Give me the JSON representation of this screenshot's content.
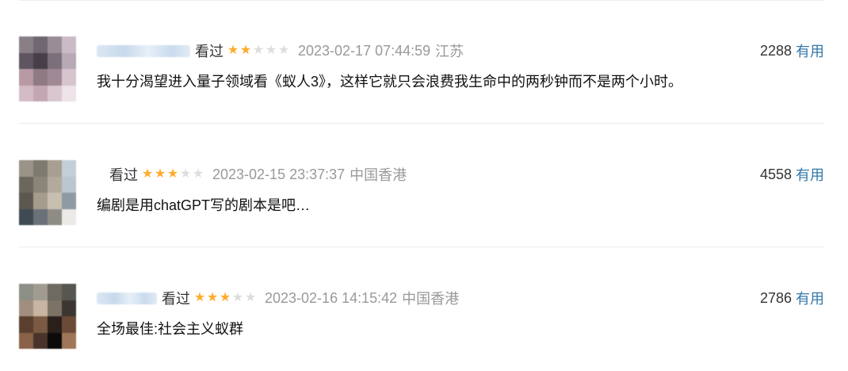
{
  "comments": [
    {
      "status": "看过",
      "rating": 2,
      "time": "2023-02-17 07:44:59",
      "location": "江苏",
      "votes": "2288",
      "useful_label": "有用",
      "text": "我十分渴望进入量子领域看《蚁人3》，这样它就只会浪费我生命中的两秒钟而不是两个小时。"
    },
    {
      "status": "看过",
      "rating": 3,
      "time": "2023-02-15 23:37:37",
      "location": "中国香港",
      "votes": "4558",
      "useful_label": "有用",
      "text": "编剧是用chatGPT写的剧本是吧…"
    },
    {
      "status": "看过",
      "rating": 3,
      "time": "2023-02-16 14:15:42",
      "location": "中国香港",
      "votes": "2786",
      "useful_label": "有用",
      "text": "全场最佳:社会主义蚁群"
    }
  ],
  "colors": {
    "star_on": "#ffac2d",
    "star_off": "#dddddd",
    "link": "#3377aa",
    "muted": "#999999"
  }
}
